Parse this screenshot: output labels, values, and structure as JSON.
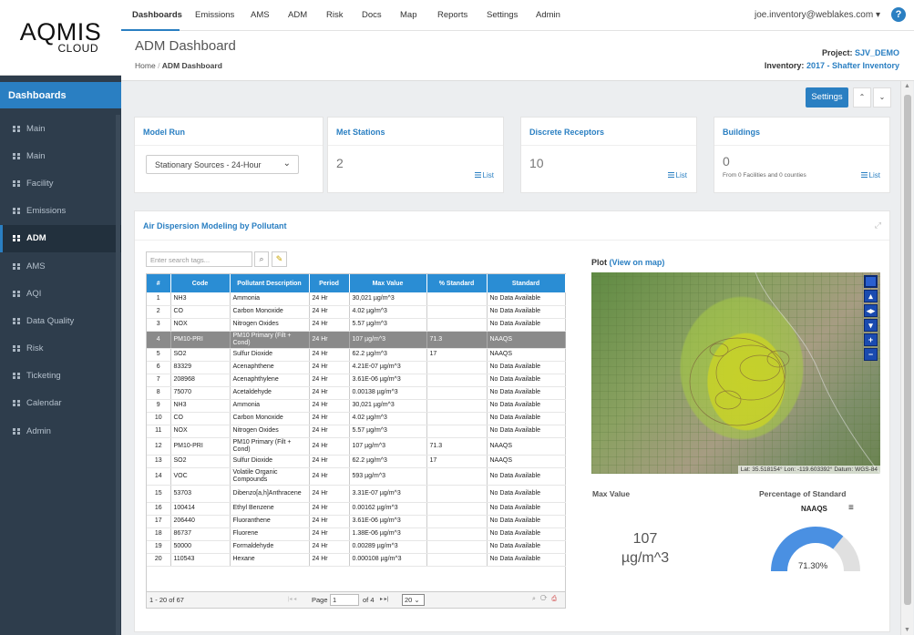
{
  "brand": {
    "name": "AQMIS",
    "sub": "CLOUD"
  },
  "sidebar": {
    "header": "Dashboards",
    "items": [
      {
        "label": "Main"
      },
      {
        "label": "Main"
      },
      {
        "label": "Facility"
      },
      {
        "label": "Emissions"
      },
      {
        "label": "ADM"
      },
      {
        "label": "AMS"
      },
      {
        "label": "AQI"
      },
      {
        "label": "Data Quality"
      },
      {
        "label": "Risk"
      },
      {
        "label": "Ticketing"
      },
      {
        "label": "Calendar"
      },
      {
        "label": "Admin"
      }
    ],
    "active_index": 4
  },
  "nav": {
    "items": [
      "Dashboards",
      "Emissions",
      "AMS",
      "ADM",
      "Risk",
      "Docs",
      "Map",
      "Reports",
      "Settings",
      "Admin"
    ],
    "active": "Dashboards",
    "user": "joe.inventory@weblakes.com",
    "help": "?"
  },
  "header": {
    "title": "ADM Dashboard",
    "breadcrumb_home": "Home",
    "breadcrumb_current": "ADM Dashboard",
    "project_label": "Project:",
    "project_value": "SJV_DEMO",
    "inventory_label": "Inventory:",
    "inventory_value": "2017 - Shafter Inventory"
  },
  "toolbar": {
    "settings_label": "Settings"
  },
  "cards": {
    "model_run": {
      "title": "Model Run",
      "selected": "Stationary Sources - 24-Hour"
    },
    "met_stations": {
      "title": "Met Stations",
      "count": "2",
      "link": "List"
    },
    "discrete_receptors": {
      "title": "Discrete Receptors",
      "count": "10",
      "link": "List"
    },
    "buildings": {
      "title": "Buildings",
      "count": "0",
      "sub": "From 0 Facilities and 0 counties",
      "link": "List"
    }
  },
  "adm": {
    "title": "Air Dispersion Modeling by Pollutant",
    "search_placeholder": "Enter search tags...",
    "columns": [
      "#",
      "Code",
      "Pollutant Description",
      "Period",
      "Max Value",
      "% Standard",
      "Standard"
    ],
    "rows": [
      [
        "1",
        "NH3",
        "Ammonia",
        "24 Hr",
        "30,021 µg/m^3",
        "",
        "No Data Available"
      ],
      [
        "2",
        "CO",
        "Carbon Monoxide",
        "24 Hr",
        "4.02 µg/m^3",
        "",
        "No Data Available"
      ],
      [
        "3",
        "NOX",
        "Nitrogen Oxides",
        "24 Hr",
        "5.57 µg/m^3",
        "",
        "No Data Available"
      ],
      [
        "4",
        "PM10-PRI",
        "PM10 Primary (Filt + Cond)",
        "24 Hr",
        "107 µg/m^3",
        "71.3",
        "NAAQS"
      ],
      [
        "5",
        "SO2",
        "Sulfur Dioxide",
        "24 Hr",
        "62.2 µg/m^3",
        "17",
        "NAAQS"
      ],
      [
        "6",
        "83329",
        "Acenaphthene",
        "24 Hr",
        "4.21E-07 µg/m^3",
        "",
        "No Data Available"
      ],
      [
        "7",
        "208968",
        "Acenaphthylene",
        "24 Hr",
        "3.61E-06 µg/m^3",
        "",
        "No Data Available"
      ],
      [
        "8",
        "75070",
        "Acetaldehyde",
        "24 Hr",
        "0.00138 µg/m^3",
        "",
        "No Data Available"
      ],
      [
        "9",
        "NH3",
        "Ammonia",
        "24 Hr",
        "30,021 µg/m^3",
        "",
        "No Data Available"
      ],
      [
        "10",
        "CO",
        "Carbon Monoxide",
        "24 Hr",
        "4.02 µg/m^3",
        "",
        "No Data Available"
      ],
      [
        "11",
        "NOX",
        "Nitrogen Oxides",
        "24 Hr",
        "5.57 µg/m^3",
        "",
        "No Data Available"
      ],
      [
        "12",
        "PM10-PRI",
        "PM10 Primary (Filt + Cond)",
        "24 Hr",
        "107 µg/m^3",
        "71.3",
        "NAAQS"
      ],
      [
        "13",
        "SO2",
        "Sulfur Dioxide",
        "24 Hr",
        "62.2 µg/m^3",
        "17",
        "NAAQS"
      ],
      [
        "14",
        "VOC",
        "Volatile Organic Compounds",
        "24 Hr",
        "593 µg/m^3",
        "",
        "No Data Available"
      ],
      [
        "15",
        "53703",
        "Dibenzo[a,h]Anthracene",
        "24 Hr",
        "3.31E-07 µg/m^3",
        "",
        "No Data Available"
      ],
      [
        "16",
        "100414",
        "Ethyl Benzene",
        "24 Hr",
        "0.00162 µg/m^3",
        "",
        "No Data Available"
      ],
      [
        "17",
        "206440",
        "Fluoranthene",
        "24 Hr",
        "3.61E-06 µg/m^3",
        "",
        "No Data Available"
      ],
      [
        "18",
        "86737",
        "Fluorene",
        "24 Hr",
        "1.38E-06 µg/m^3",
        "",
        "No Data Available"
      ],
      [
        "19",
        "50000",
        "Formaldehyde",
        "24 Hr",
        "0.00289 µg/m^3",
        "",
        "No Data Available"
      ],
      [
        "20",
        "110543",
        "Hexane",
        "24 Hr",
        "0.000108 µg/m^3",
        "",
        "No Data Available"
      ]
    ],
    "selected_row": 3,
    "pager": {
      "count": "1 - 20 of 67",
      "page_label": "Page",
      "page": "1",
      "of": "of 4",
      "page_size": "20"
    },
    "plot_label": "Plot",
    "plot_link": "(View on map)",
    "map_status": "Lat: 35.518154°   Lon: -119.603392°   Datum: WGS-84",
    "max_value_label": "Max Value",
    "max_value": "107",
    "max_value_unit": "µg/m^3",
    "pct_label": "Percentage of Standard",
    "pct_standard": "NAAQS",
    "pct_value_text": "71.30%",
    "pct_value": 71.3,
    "colors": {
      "accent": "#2a7fc2",
      "gauge_fill": "#4a90e2",
      "gauge_track": "#e0e0e0"
    }
  }
}
